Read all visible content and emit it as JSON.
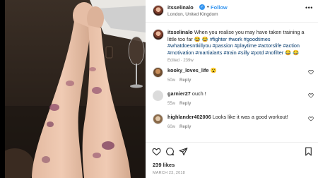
{
  "post": {
    "username": "itsselinalo",
    "follow_label": "Follow",
    "dot": "•",
    "location": "London, United Kingdom",
    "more_label": "•••"
  },
  "caption": {
    "username": "itsselinalo",
    "text_plain": "When you realise you may have taken training a little too far 😂 😂",
    "hashtags": "#fighter #work #goodtimes #whatdoesntkillyou #passion #playtime #actorslife #action #motivation #martialarts #train #silly #potd #nofilter 😂 😂",
    "meta": "Edited · 239w"
  },
  "comments": [
    {
      "username": "kooky_loves_life",
      "text": "😮",
      "time": "50w",
      "reply": "Reply"
    },
    {
      "username": "garnier27",
      "text": "ouch !",
      "time": "55w",
      "reply": "Reply"
    },
    {
      "username": "highlander402006",
      "text": "Looks like it was a good workout!",
      "time": "60w",
      "reply": "Reply"
    }
  ],
  "footer": {
    "likes": "239 likes",
    "date": "MARCH 23, 2018"
  },
  "icons": {
    "heart": "heart-icon",
    "comment": "comment-icon",
    "share": "share-icon",
    "save": "bookmark-icon"
  },
  "colors": {
    "link": "#00376b",
    "verified": "#3897f0",
    "follow": "#3897f0",
    "muted": "#8e8e8e"
  }
}
